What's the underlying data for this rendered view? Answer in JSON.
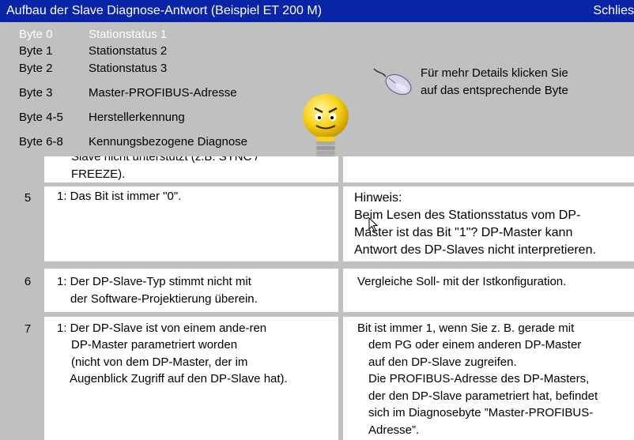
{
  "window": {
    "title": "Aufbau der Slave Diagnose-Antwort (Beispiel ET 200 M)",
    "close_label": "Schlies"
  },
  "bytes": [
    {
      "byte": "Byte 0",
      "label": "Stationstatus 1"
    },
    {
      "byte": "Byte 1",
      "label": "Stationstatus 2"
    },
    {
      "byte": "Byte 2",
      "label": "Stationstatus 3"
    },
    {
      "byte": "Byte 3",
      "label": "Master-PROFIBUS-Adresse"
    },
    {
      "byte": "Byte 4-5",
      "label": "Herstellerkennung"
    },
    {
      "byte": "Byte 6-8",
      "label": "Kennungsbezogene Diagnose"
    }
  ],
  "hint": {
    "line1": "Für mehr Details klicken Sie",
    "line2": "auf das entsprechende Byte"
  },
  "table": {
    "partial": {
      "line1": "Slave nicht unterstützt (z.B. SYNC /",
      "line2": "FREEZE)."
    },
    "rows": [
      {
        "num": "5",
        "meaning": [
          "1: Das Bit ist immer \"0\"."
        ],
        "remedy": [
          "Hinweis:",
          "Beim Lesen des Stationsstatus vom DP-",
          "Master ist das Bit \"1\"? DP-Master kann",
          "Antwort des DP-Slaves nicht interpretieren."
        ]
      },
      {
        "num": "6",
        "meaning": [
          "1: Der DP-Slave-Typ stimmt nicht mit",
          "der Software-Projektierung überein."
        ],
        "remedy": [
          "Vergleiche Soll- mit der Istkonfiguration."
        ]
      },
      {
        "num": "7",
        "meaning": [
          "1: Der DP-Slave ist von einem ande-ren",
          "DP-Master parametriert worden",
          "(nicht von dem DP-Master, der im",
          "Augenblick Zugriff auf den DP-Slave hat)."
        ],
        "remedy": [
          "Bit ist immer 1, wenn Sie z. B. gerade mit",
          "dem PG oder einem anderen DP-Master",
          "auf den DP-Slave zugreifen.",
          "Die PROFIBUS-Adresse des DP-Masters,",
          "der den DP-Slave parametriert hat, befindet",
          "sich im Diagnosebyte ”Master-PROFIBUS-",
          "Adresse”."
        ]
      }
    ]
  }
}
